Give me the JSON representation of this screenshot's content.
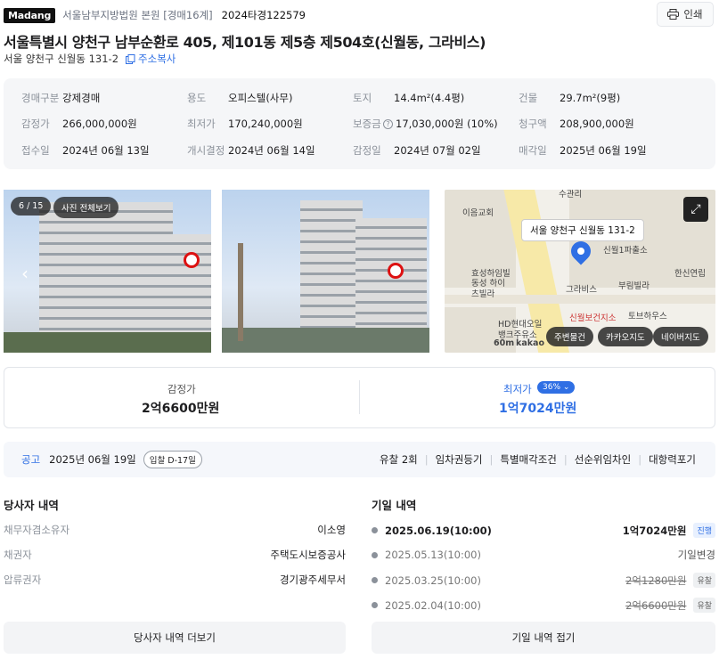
{
  "header": {
    "brand": "Madang",
    "court": "서울남부지방법원 본원 [경매16계]",
    "case_no": "2024타경122579",
    "print_label": "인쇄"
  },
  "title": "서울특별시 양천구 남부순환로 405, 제101동 제5층 제504호(신월동, 그라비스)",
  "sub_address": "서울 양천구 신월동 131-2",
  "copy_label": "주소복사",
  "info": {
    "auction_type_k": "경매구분",
    "auction_type_v": "강제경매",
    "usage_k": "용도",
    "usage_v": "오피스텔(사무)",
    "land_k": "토지",
    "land_v": "14.4m²(4.4평)",
    "building_k": "건물",
    "building_v": "29.7m²(9평)",
    "appraisal_k": "감정가",
    "appraisal_v": "266,000,000원",
    "min_k": "최저가",
    "min_v": "170,240,000원",
    "deposit_k": "보증금",
    "deposit_v": "17,030,000원 (10%)",
    "claim_k": "청구액",
    "claim_v": "208,900,000원",
    "received_k": "접수일",
    "received_v": "2024년 06월 13일",
    "start_k": "개시결정",
    "start_v": "2024년 06월 14일",
    "appraisal_date_k": "감정일",
    "appraisal_date_v": "2024년 07월 02일",
    "sale_k": "매각일",
    "sale_v": "2025년 06월 19일"
  },
  "photos": {
    "counter": "6 / 15",
    "view_all": "사진 전체보기"
  },
  "map": {
    "callout": "서울 양천구 신월동 131-2",
    "place": "그라비스",
    "labels": [
      "이음교회",
      "신월1파출소",
      "한신연립",
      "부림빌라",
      "효성하임빌",
      "동성 하이츠빌라",
      "신월보건지소",
      "토브하우스",
      "HD현대오일 뱅크주유소",
      "수관리",
      "60m",
      "kakao"
    ],
    "btn_nearby": "주변물건",
    "btn_kakao": "카카오지도",
    "btn_naver": "네이버지도"
  },
  "prices": {
    "appraisal_label": "감정가",
    "appraisal_value": "2억6600만원",
    "min_label": "최저가",
    "min_pct": "36%",
    "min_value": "1억7024만원"
  },
  "notice": {
    "label": "공고",
    "date": "2025년 06월 19일",
    "dday": "입찰 D-17일",
    "tags": [
      "유찰 2회",
      "임차권등기",
      "특별매각조건",
      "선순위임차인",
      "대항력포기"
    ]
  },
  "parties": {
    "title": "당사자 내역",
    "rows": [
      {
        "k": "채무자겸소유자",
        "v": "이소영"
      },
      {
        "k": "채권자",
        "v": "주택도시보증공사"
      },
      {
        "k": "압류권자",
        "v": "경기광주세무서"
      }
    ],
    "more": "당사자 내역 더보기"
  },
  "dates": {
    "title": "기일 내역",
    "rows": [
      {
        "date": "2025.06.19(10:00)",
        "amount": "1억7024만원",
        "status": "진행"
      },
      {
        "date": "2025.05.13(10:00)",
        "amount": "기일변경",
        "status": ""
      },
      {
        "date": "2025.03.25(10:00)",
        "amount": "2억1280만원",
        "status": "유찰"
      },
      {
        "date": "2025.02.04(10:00)",
        "amount": "2억6600만원",
        "status": "유찰"
      }
    ],
    "fold": "기일 내역 접기"
  },
  "colors": {
    "accent": "#2f6fe4",
    "panel": "#f5f6f8"
  }
}
